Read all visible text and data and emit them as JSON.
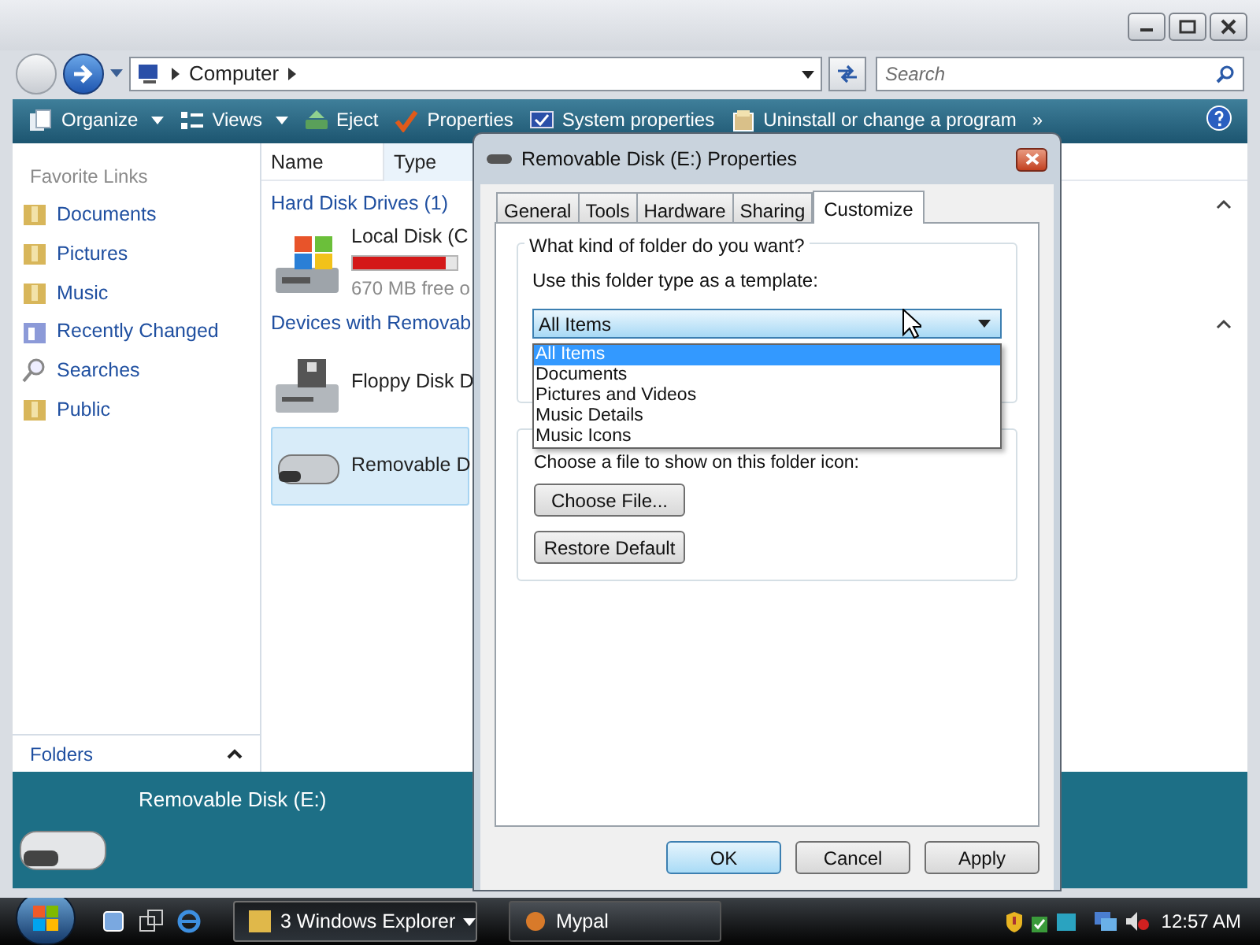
{
  "explorer": {
    "address": [
      "Computer"
    ],
    "search": {
      "placeholder": "Search"
    },
    "toolbar": [
      {
        "label": "Organize",
        "kind": "pages",
        "menu": true
      },
      {
        "label": "Views",
        "kind": "views",
        "menu": true
      },
      {
        "label": "Eject",
        "kind": "eject",
        "menu": false
      },
      {
        "label": "Properties",
        "kind": "check",
        "menu": false
      },
      {
        "label": "System properties",
        "kind": "screen",
        "menu": false
      },
      {
        "label": "Uninstall or change a program",
        "kind": "box",
        "menu": false
      },
      {
        "label": "»",
        "kind": "more",
        "menu": false
      }
    ],
    "favorite_links_title": "Favorite Links",
    "favorite_links": [
      {
        "label": "Documents",
        "kind": "folder"
      },
      {
        "label": "Pictures",
        "kind": "folder"
      },
      {
        "label": "Music",
        "kind": "folder"
      },
      {
        "label": "Recently Changed",
        "kind": "recent"
      },
      {
        "label": "Searches",
        "kind": "search"
      },
      {
        "label": "Public",
        "kind": "folder"
      }
    ],
    "folders_label": "Folders",
    "columns": [
      "Name",
      "Type"
    ],
    "groups": [
      {
        "title": "Hard Disk Drives (1)",
        "items": [
          {
            "name": "Local Disk (C",
            "kind": "hdd",
            "info": "670 MB free o",
            "level": 0.9,
            "selected": false
          }
        ]
      },
      {
        "title": "Devices with Removab",
        "items": [
          {
            "name": "Floppy Disk D",
            "kind": "floppy",
            "selected": false
          },
          {
            "name": "Removable D",
            "kind": "removable",
            "selected": true
          }
        ]
      }
    ],
    "details_title": "Removable Disk (E:)"
  },
  "dialog": {
    "title": "Removable Disk (E:) Properties",
    "tabs": [
      {
        "label": "General",
        "selected": false
      },
      {
        "label": "Tools",
        "selected": false
      },
      {
        "label": "Hardware",
        "selected": false
      },
      {
        "label": "Sharing",
        "selected": false
      },
      {
        "label": "Customize",
        "selected": true
      }
    ],
    "group_title": "What kind of folder do you want?",
    "template_label": "Use this folder type as a template:",
    "template_value": "All Items",
    "options": [
      {
        "label": "All Items",
        "selected": true
      },
      {
        "label": "Documents",
        "selected": false
      },
      {
        "label": "Pictures and Videos",
        "selected": false
      },
      {
        "label": "Music Details",
        "selected": false
      },
      {
        "label": "Music Icons",
        "selected": false
      }
    ],
    "icon_hint": "Choose a file to show on this folder icon:",
    "icon_buttons": [
      "Choose File...",
      "Restore Default"
    ],
    "buttons": [
      {
        "label": "OK",
        "default": true
      },
      {
        "label": "Cancel",
        "default": false
      },
      {
        "label": "Apply",
        "default": false
      }
    ]
  },
  "taskbar": {
    "tasks": [
      {
        "label": "3 Windows Explorer",
        "kind": "folder",
        "selected": true,
        "menu": true
      },
      {
        "label": "Mypal",
        "kind": "app",
        "selected": false,
        "menu": false
      }
    ],
    "clock": "12:57 AM"
  }
}
